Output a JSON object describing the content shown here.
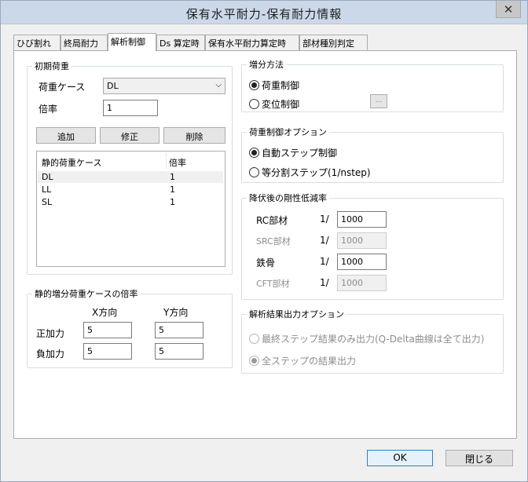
{
  "window": {
    "title": "保有水平耐力-保有耐力情報",
    "close_glyph": "✕"
  },
  "tabs": [
    {
      "label": "ひび割れ"
    },
    {
      "label": "終局耐力"
    },
    {
      "label": "解析制御"
    },
    {
      "label": "Ds 算定時"
    },
    {
      "label": "保有水平耐力算定時"
    },
    {
      "label": "部材種別判定"
    }
  ],
  "initial_load": {
    "group_label": "初期荷重",
    "case_label": "荷重ケース",
    "case_value": "DL",
    "ratio_label": "倍率",
    "ratio_value": "1",
    "add_button": "追加",
    "edit_button": "修正",
    "delete_button": "削除",
    "list_headers": [
      "静的荷重ケース",
      "倍率"
    ],
    "rows": [
      {
        "case": "DL",
        "ratio": "1"
      },
      {
        "case": "LL",
        "ratio": "1"
      },
      {
        "case": "SL",
        "ratio": "1"
      }
    ]
  },
  "incremental": {
    "group_label": "静的増分荷重ケースの倍率",
    "x_label": "X方向",
    "y_label": "Y方向",
    "pos_label": "正加力",
    "neg_label": "負加力",
    "pos_x": "5",
    "pos_y": "5",
    "neg_x": "5",
    "neg_y": "5"
  },
  "increment_method": {
    "group_label": "増分方法",
    "load_control": "荷重制御",
    "disp_control": "変位制御",
    "more_button": "..."
  },
  "load_control_options": {
    "group_label": "荷重制御オプション",
    "auto_step": "自動ステップ制御",
    "equal_step": "等分割ステップ(1/nstep)"
  },
  "stiffness_reduction": {
    "group_label": "降伏後の剛性低減率",
    "prefix": "1/",
    "rc_label": "RC部材",
    "rc_value": "1000",
    "src_label": "SRC部材",
    "src_value": "1000",
    "steel_label": "鉄骨",
    "steel_value": "1000",
    "cft_label": "CFT部材",
    "cft_value": "1000"
  },
  "output_options": {
    "group_label": "解析結果出力オプション",
    "final_only": "最終ステップ結果のみ出力(Q-Delta曲線は全て出力)",
    "all_steps": "全ステップの結果出力"
  },
  "footer": {
    "ok_label": "OK",
    "close_label": "閉じる"
  }
}
